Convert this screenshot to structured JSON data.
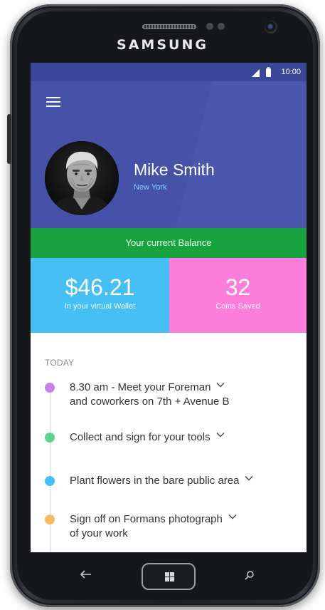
{
  "device": {
    "brand": "SAMSUNG"
  },
  "status_bar": {
    "time": "10:00"
  },
  "profile": {
    "name": "Mike Smith",
    "location": "New York"
  },
  "balance": {
    "label": "Your current Balance",
    "wallet_amount": "$46.21",
    "wallet_caption": "In your virtual Wallet",
    "coins_amount": "32",
    "coins_caption": "Coins Saved"
  },
  "schedule": {
    "heading": "TODAY",
    "tasks": [
      {
        "line1": "8.30 am - Meet your Foreman",
        "line2": "and coworkers on 7th + Avenue B",
        "color": "#c781e8"
      },
      {
        "line1": "Collect and sign for your tools",
        "line2": "",
        "color": "#5ed38f"
      },
      {
        "line1": "Plant flowers in the bare public area",
        "line2": "",
        "color": "#46bff4"
      },
      {
        "line1": "Sign off on Formans photograph",
        "line2": "of your work",
        "color": "#f8b960"
      }
    ]
  },
  "colors": {
    "header": "#4552a8",
    "status_bar": "#3a4798",
    "balance_bar": "#17a340",
    "wallet_tile": "#46bff4",
    "coins_tile": "#fc7ddc",
    "location_text": "#7fd3ff"
  },
  "icons": {
    "menu": "hamburger-icon",
    "chevron": "chevron-down-icon",
    "back": "back-arrow-icon",
    "home": "windows-logo-icon",
    "search": "search-icon"
  }
}
